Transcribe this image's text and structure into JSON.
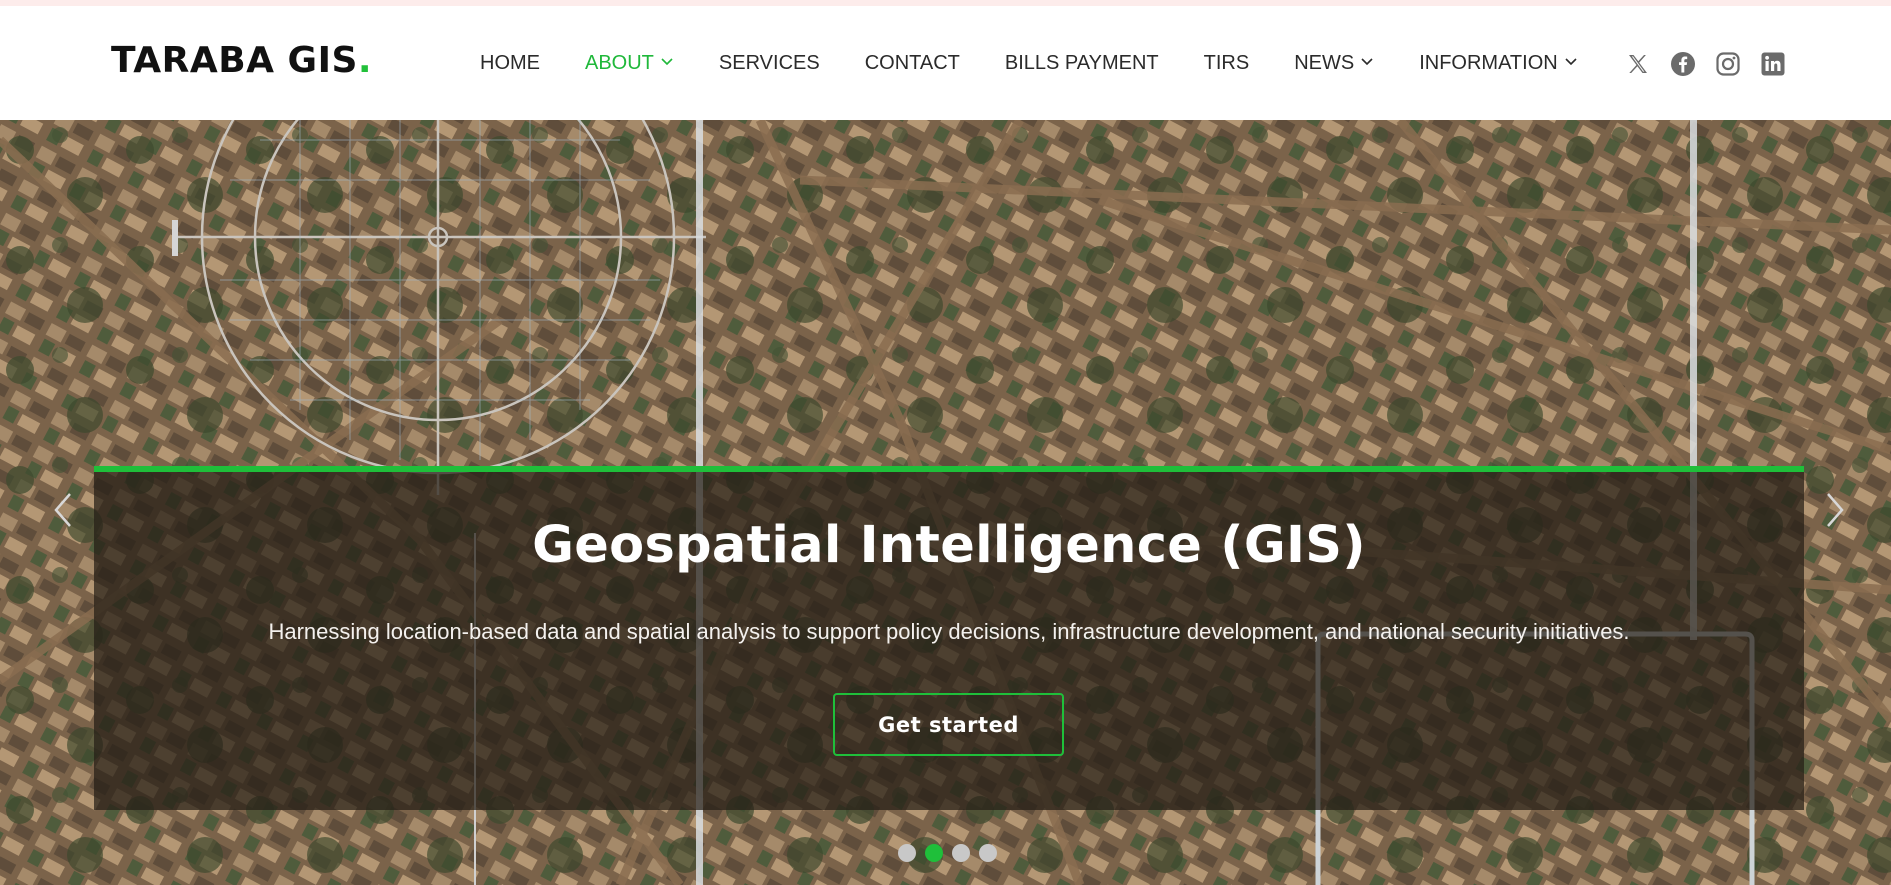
{
  "brand": {
    "name": "TARABA GIS",
    "dot": ".",
    "accent": "#22c03a"
  },
  "nav": {
    "items": [
      {
        "label": "HOME",
        "active": false,
        "dropdown": false
      },
      {
        "label": "ABOUT",
        "active": true,
        "dropdown": true
      },
      {
        "label": "SERVICES",
        "active": false,
        "dropdown": false
      },
      {
        "label": "CONTACT",
        "active": false,
        "dropdown": false
      },
      {
        "label": "BILLS PAYMENT",
        "active": false,
        "dropdown": false
      },
      {
        "label": "TIRS",
        "active": false,
        "dropdown": false
      },
      {
        "label": "NEWS",
        "active": false,
        "dropdown": true
      },
      {
        "label": "INFORMATION",
        "active": false,
        "dropdown": true
      }
    ]
  },
  "socials": [
    "x-icon",
    "facebook-icon",
    "instagram-icon",
    "linkedin-icon"
  ],
  "hero": {
    "title": "Geospatial Intelligence (GIS)",
    "subtitle": "Harnessing location-based data and spatial analysis to support policy decisions, infrastructure development, and national security initiatives.",
    "cta_label": "Get started",
    "slides": 4,
    "active_slide": 1,
    "accent": "#1fbf3a"
  }
}
